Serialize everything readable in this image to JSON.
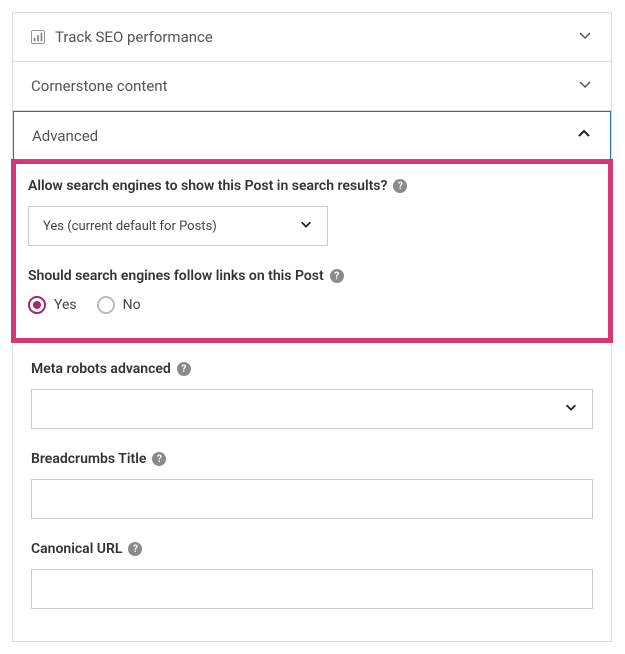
{
  "panels": {
    "seo": {
      "title": "Track SEO performance"
    },
    "cornerstone": {
      "title": "Cornerstone content"
    },
    "advanced": {
      "title": "Advanced"
    }
  },
  "advanced": {
    "searchResults": {
      "label": "Allow search engines to show this Post in search results?",
      "value": "Yes (current default for Posts)"
    },
    "followLinks": {
      "label": "Should search engines follow links on this Post",
      "options": {
        "yes": "Yes",
        "no": "No"
      },
      "selected": "yes"
    },
    "metaRobots": {
      "label": "Meta robots advanced",
      "value": ""
    },
    "breadcrumbs": {
      "label": "Breadcrumbs Title",
      "value": ""
    },
    "canonical": {
      "label": "Canonical URL",
      "value": ""
    }
  }
}
